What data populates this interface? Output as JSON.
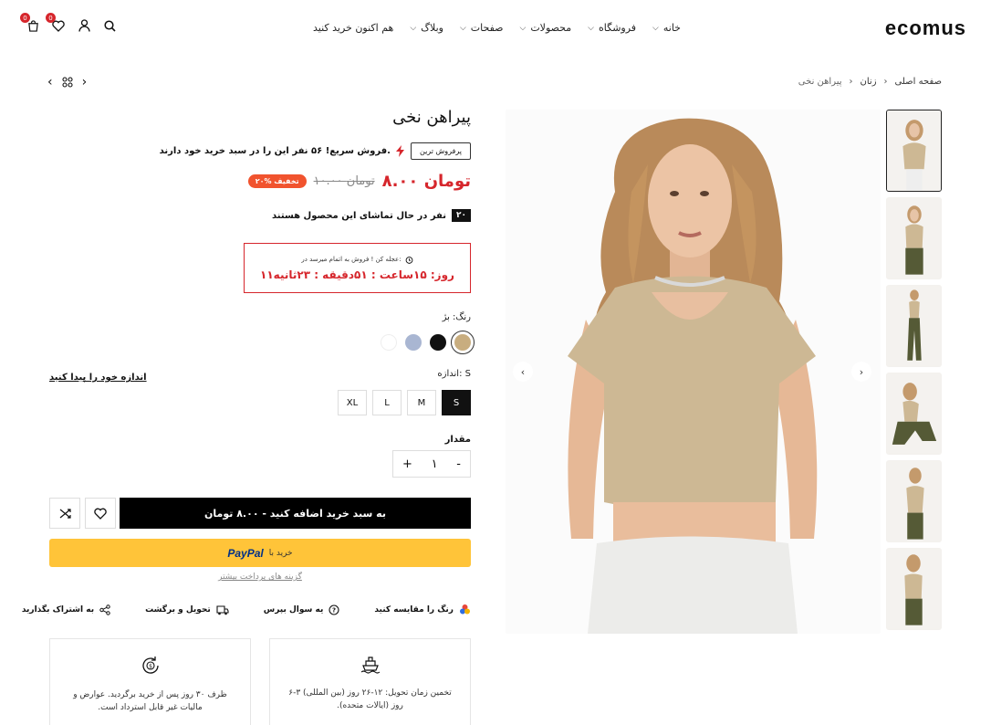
{
  "header": {
    "logo": "ecomus",
    "nav": [
      "خانه",
      "فروشگاه",
      "محصولات",
      "صفحات",
      "وبلاگ",
      "هم اکنون خرید کنید"
    ],
    "cart_count": "0",
    "wishlist_count": "0"
  },
  "breadcrumb": {
    "home": "صفحه اصلی",
    "category": "زنان",
    "current": "پیراهن نخی"
  },
  "product": {
    "title": "پیراهن نخی",
    "best_seller": "پرفروش ترین",
    "hot_text": "فروش سریع! ۵۶ نفر این را در سبد خرید خود دارند.",
    "price": "۸.۰۰ تومان",
    "old_price": "۱۰.۰۰ تومان",
    "discount": "۲۰% تخفیف",
    "viewers_count": "۲۰",
    "viewers_text": "نفر در حال تماشای این محصول هستند",
    "countdown_label": "عجله کن ! فروش به اتمام میرسد در:",
    "countdown_time": "۱۱روز: ۱۵ساعت : ۵۱دقیقه : ۲۳ثانیه",
    "color_label": "رنگ: بژ",
    "colors": [
      "#c8ad7f",
      "#111111",
      "#a9b6d2",
      "#ffffff"
    ],
    "size_label": "اندازه: S",
    "sizes": [
      "S",
      "M",
      "L",
      "XL"
    ],
    "size_guide": "اندازه خود را پیدا کنید",
    "qty_label": "مقدار",
    "qty": "۱",
    "add_to_cart": "به سبد خرید اضافه کنید - ۸.۰۰ تومان",
    "paypal_prefix": "خرید با",
    "paypal_brand": "PayPal",
    "more_payment": "گزینه های پرداخت بیشتر"
  },
  "actions": {
    "compare": "رنگ را مقایسه کنید",
    "question": "یه سوال بپرس",
    "delivery": "تحویل و برگشت",
    "share": "به اشتراک بگذارید"
  },
  "cards": {
    "shipping": "تخمین زمان تحویل: ۱۲-۲۶ روز (بین المللی) ۳-۶ روز (ایالات متحده).",
    "returns": "ظرف ۳۰ روز پس از خرید برگردید. عوارض و مالیات غیر قابل استرداد است."
  },
  "colors": {
    "accent": "#d6262c",
    "discount": "#f1532e",
    "paypal": "#ffc439"
  }
}
